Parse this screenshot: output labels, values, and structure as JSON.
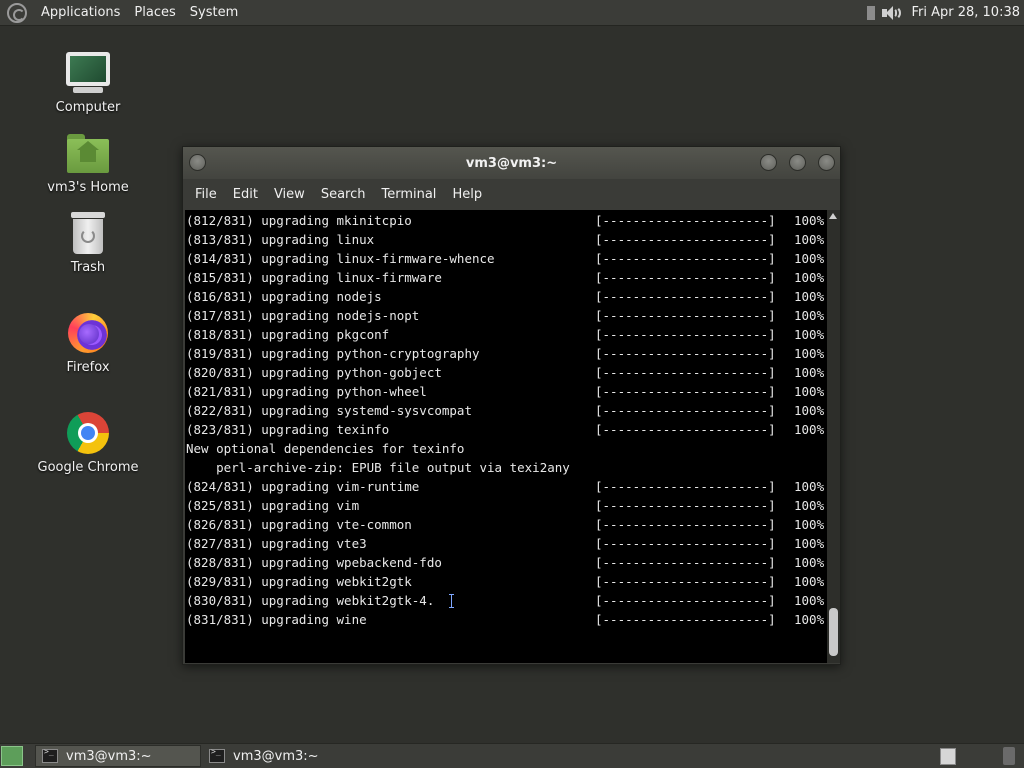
{
  "top_panel": {
    "menus": [
      "Applications",
      "Places",
      "System"
    ],
    "clock": "Fri Apr 28, 10:38"
  },
  "desktop_icons": [
    {
      "label": "Computer",
      "icon": "computer-icon"
    },
    {
      "label": "vm3's Home",
      "icon": "home-folder-icon"
    },
    {
      "label": "Trash",
      "icon": "trash-icon"
    },
    {
      "label": "Firefox",
      "icon": "firefox-icon"
    },
    {
      "label": "Google Chrome",
      "icon": "chrome-icon"
    }
  ],
  "terminal": {
    "title": "vm3@vm3:~",
    "menu": [
      "File",
      "Edit",
      "View",
      "Search",
      "Terminal",
      "Help"
    ],
    "lines": [
      {
        "pkg": "(812/831) upgrading mkinitcpio",
        "bar": "[----------------------]",
        "pct": "100%"
      },
      {
        "pkg": "(813/831) upgrading linux",
        "bar": "[----------------------]",
        "pct": "100%"
      },
      {
        "pkg": "(814/831) upgrading linux-firmware-whence",
        "bar": "[----------------------]",
        "pct": "100%"
      },
      {
        "pkg": "(815/831) upgrading linux-firmware",
        "bar": "[----------------------]",
        "pct": "100%"
      },
      {
        "pkg": "(816/831) upgrading nodejs",
        "bar": "[----------------------]",
        "pct": "100%"
      },
      {
        "pkg": "(817/831) upgrading nodejs-nopt",
        "bar": "[----------------------]",
        "pct": "100%"
      },
      {
        "pkg": "(818/831) upgrading pkgconf",
        "bar": "[----------------------]",
        "pct": "100%"
      },
      {
        "pkg": "(819/831) upgrading python-cryptography",
        "bar": "[----------------------]",
        "pct": "100%"
      },
      {
        "pkg": "(820/831) upgrading python-gobject",
        "bar": "[----------------------]",
        "pct": "100%"
      },
      {
        "pkg": "(821/831) upgrading python-wheel",
        "bar": "[----------------------]",
        "pct": "100%"
      },
      {
        "pkg": "(822/831) upgrading systemd-sysvcompat",
        "bar": "[----------------------]",
        "pct": "100%"
      },
      {
        "pkg": "(823/831) upgrading texinfo",
        "bar": "[----------------------]",
        "pct": "100%"
      },
      {
        "pkg": "New optional dependencies for texinfo",
        "bar": "",
        "pct": ""
      },
      {
        "pkg": "    perl-archive-zip: EPUB file output via texi2any",
        "bar": "",
        "pct": ""
      },
      {
        "pkg": "(824/831) upgrading vim-runtime",
        "bar": "[----------------------]",
        "pct": "100%"
      },
      {
        "pkg": "(825/831) upgrading vim",
        "bar": "[----------------------]",
        "pct": "100%"
      },
      {
        "pkg": "(826/831) upgrading vte-common",
        "bar": "[----------------------]",
        "pct": "100%"
      },
      {
        "pkg": "(827/831) upgrading vte3",
        "bar": "[----------------------]",
        "pct": "100%"
      },
      {
        "pkg": "(828/831) upgrading wpebackend-fdo",
        "bar": "[----------------------]",
        "pct": "100%"
      },
      {
        "pkg": "(829/831) upgrading webkit2gtk",
        "bar": "[----------------------]",
        "pct": "100%"
      },
      {
        "pkg": "(830/831) upgrading webkit2gtk-4.",
        "bar": "[----------------------]",
        "pct": "100%"
      },
      {
        "pkg": "(831/831) upgrading wine",
        "bar": "[----------------------]",
        "pct": "100%"
      }
    ]
  },
  "taskbar": {
    "tasks": [
      {
        "label": "vm3@vm3:~",
        "active": true
      },
      {
        "label": "vm3@vm3:~",
        "active": false
      }
    ]
  }
}
